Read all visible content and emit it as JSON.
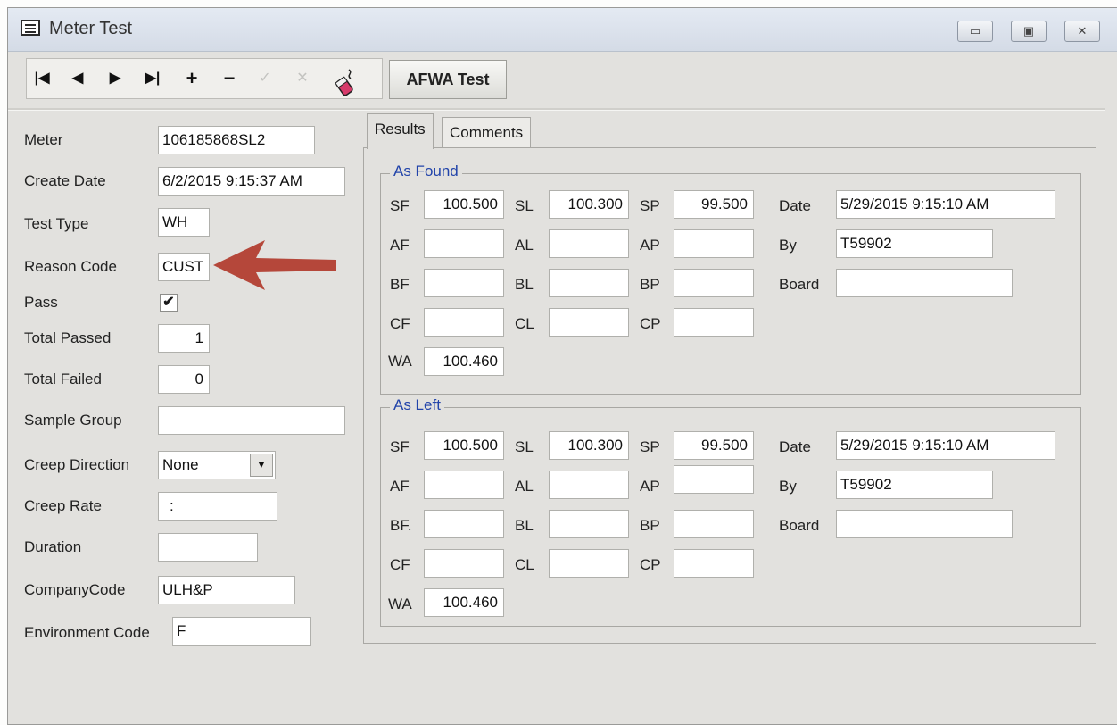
{
  "window": {
    "title": "Meter Test",
    "icon": "window-form-icon"
  },
  "window_controls": {
    "minimize": "▭",
    "restore": "▣",
    "close": "✕"
  },
  "toolbar": {
    "first": "|◀",
    "prev": "◀",
    "next": "▶",
    "last": "▶|",
    "add": "+",
    "remove": "−",
    "confirm": "✓",
    "cancel": "✕",
    "edit_icon": "pencil-eraser-icon",
    "afwa_label": "AFWA Test"
  },
  "form": {
    "meter_label": "Meter",
    "meter_value": "106185868SL2",
    "create_date_label": "Create Date",
    "create_date_value": "6/2/2015 9:15:37 AM",
    "test_type_label": "Test Type",
    "test_type_value": "WH",
    "reason_code_label": "Reason Code",
    "reason_code_value": "CUST",
    "pass_label": "Pass",
    "pass_checked": "✔",
    "total_passed_label": "Total Passed",
    "total_passed_value": "1",
    "total_failed_label": "Total Failed",
    "total_failed_value": "0",
    "sample_group_label": "Sample Group",
    "sample_group_value": "",
    "creep_direction_label": "Creep Direction",
    "creep_direction_value": "None",
    "creep_rate_label": "Creep Rate",
    "creep_rate_value": ":",
    "duration_label": "Duration",
    "duration_value": "",
    "company_code_label": "CompanyCode",
    "company_code_value": "ULH&P",
    "environment_code_label": "Environment Code",
    "environment_code_value": "F"
  },
  "annotation": {
    "arrow_color": "#b5473a"
  },
  "tabs": {
    "results": "Results",
    "comments": "Comments"
  },
  "as_found": {
    "title": "As Found",
    "sf_label": "SF",
    "sf": "100.500",
    "sl_label": "SL",
    "sl": "100.300",
    "sp_label": "SP",
    "sp": "99.500",
    "af_label": "AF",
    "af": "",
    "al_label": "AL",
    "al": "",
    "ap_label": "AP",
    "ap": "",
    "bf_label": "BF",
    "bf": "",
    "bl_label": "BL",
    "bl": "",
    "bp_label": "BP",
    "bp": "",
    "cf_label": "CF",
    "cf": "",
    "cl_label": "CL",
    "cl": "",
    "cp_label": "CP",
    "cp": "",
    "wa_label": "WA",
    "wa": "100.460",
    "date_label": "Date",
    "date": "5/29/2015 9:15:10 AM",
    "by_label": "By",
    "by": "T59902",
    "board_label": "Board",
    "board": ""
  },
  "as_left": {
    "title": "As Left",
    "sf_label": "SF",
    "sf": "100.500",
    "sl_label": "SL",
    "sl": "100.300",
    "sp_label": "SP",
    "sp": "99.500",
    "af_label": "AF",
    "af": "",
    "al_label": "AL",
    "al": "",
    "ap_label": "AP",
    "ap": "",
    "bf_label": "BF.",
    "bf": "",
    "bl_label": "BL",
    "bl": "",
    "bp_label": "BP",
    "bp": "",
    "cf_label": "CF",
    "cf": "",
    "cl_label": "CL",
    "cl": "",
    "cp_label": "CP",
    "cp": "",
    "wa_label": "WA",
    "wa": "100.460",
    "date_label": "Date",
    "date": "5/29/2015 9:15:10 AM",
    "by_label": "By",
    "by": "T59902",
    "board_label": "Board",
    "board": ""
  }
}
